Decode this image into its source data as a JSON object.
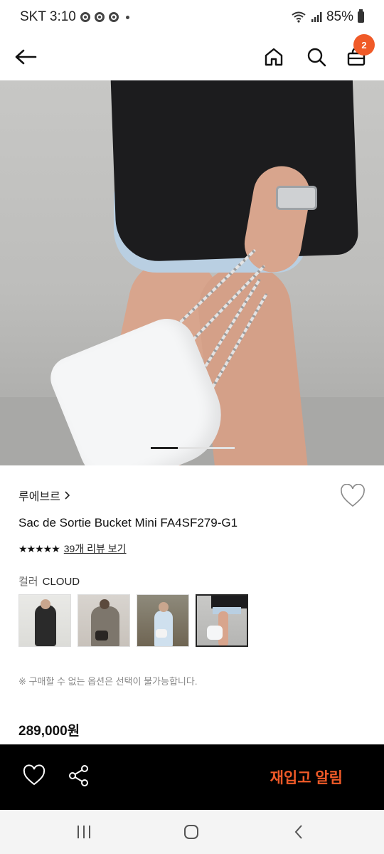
{
  "status": {
    "carrier_time": "SKT 3:10",
    "battery": "85%"
  },
  "header": {
    "back_icon": "arrow-left-icon",
    "home_icon": "home-icon",
    "search_icon": "search-icon",
    "cart_icon": "shopping-bag-icon",
    "cart_count": "2"
  },
  "hero": {
    "slide_index": 1,
    "slide_count": 3
  },
  "product": {
    "brand": "루에브르",
    "name": "Sac de Sortie Bucket Mini FA4SF279-G1",
    "stars": "★★★★★",
    "review_link": "39개 리뷰 보기",
    "color_key": "컬러",
    "color_value": "CLOUD",
    "selected_thumb_index": 3,
    "notice": "※ 구매할 수 없는 옵션은 선택이 불가능합니다.",
    "price": "289,000원"
  },
  "action_bar": {
    "restock_label": "재입고 알림",
    "wish_icon": "heart-icon",
    "share_icon": "share-icon"
  },
  "nav": {
    "recent_icon": "recent-apps-icon",
    "home_icon": "home-circle-icon",
    "back_icon": "back-chevron-icon"
  },
  "colors": {
    "accent": "#f05a28",
    "action_bar_bg": "#000000"
  }
}
